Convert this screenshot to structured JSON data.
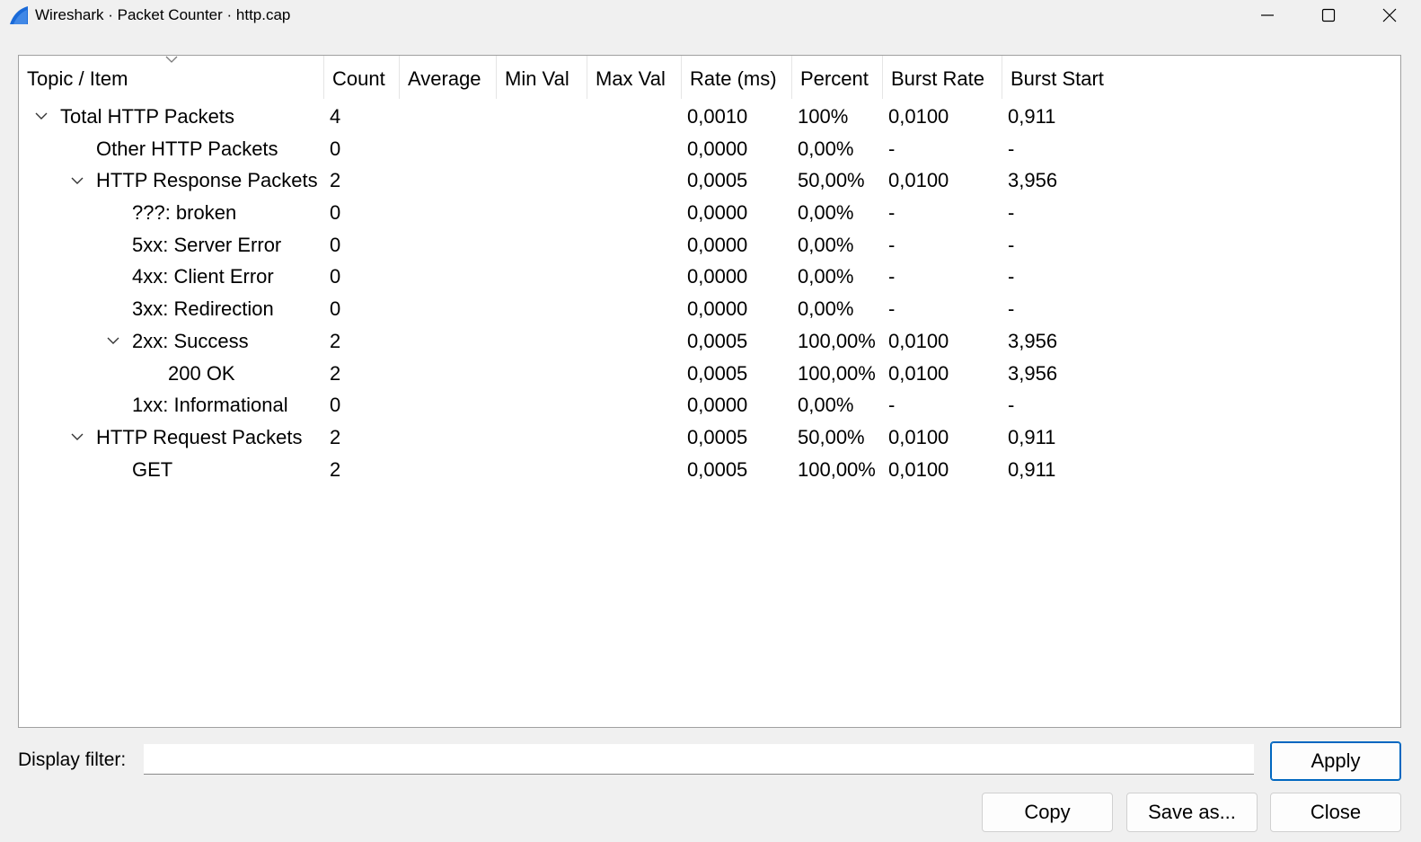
{
  "window": {
    "title": "Wireshark · Packet Counter · http.cap"
  },
  "icons": {
    "app": "wireshark-fin-icon",
    "minimize": "minimize-icon",
    "maximize": "maximize-icon",
    "close": "close-icon",
    "sort": "chevron-down-icon",
    "expand": "chevron-down-icon"
  },
  "colors": {
    "app_icon": "#1a6ad8",
    "default_button_border": "#0067c0"
  },
  "table": {
    "columns": [
      "Topic / Item",
      "Count",
      "Average",
      "Min Val",
      "Max Val",
      "Rate (ms)",
      "Percent",
      "Burst Rate",
      "Burst Start"
    ],
    "rows": [
      {
        "topic": "Total HTTP Packets",
        "level": 0,
        "expanded": true,
        "count": "4",
        "average": "",
        "min_val": "",
        "max_val": "",
        "rate": "0,0010",
        "percent": "100%",
        "burst_rate": "0,0100",
        "burst_start": "0,911"
      },
      {
        "topic": "Other HTTP Packets",
        "level": 1,
        "expanded": null,
        "count": "0",
        "average": "",
        "min_val": "",
        "max_val": "",
        "rate": "0,0000",
        "percent": "0,00%",
        "burst_rate": "-",
        "burst_start": "-"
      },
      {
        "topic": "HTTP Response Packets",
        "level": 1,
        "expanded": true,
        "count": "2",
        "average": "",
        "min_val": "",
        "max_val": "",
        "rate": "0,0005",
        "percent": "50,00%",
        "burst_rate": "0,0100",
        "burst_start": "3,956"
      },
      {
        "topic": "???: broken",
        "level": 2,
        "expanded": null,
        "count": "0",
        "average": "",
        "min_val": "",
        "max_val": "",
        "rate": "0,0000",
        "percent": "0,00%",
        "burst_rate": "-",
        "burst_start": "-"
      },
      {
        "topic": "5xx: Server Error",
        "level": 2,
        "expanded": null,
        "count": "0",
        "average": "",
        "min_val": "",
        "max_val": "",
        "rate": "0,0000",
        "percent": "0,00%",
        "burst_rate": "-",
        "burst_start": "-"
      },
      {
        "topic": "4xx: Client Error",
        "level": 2,
        "expanded": null,
        "count": "0",
        "average": "",
        "min_val": "",
        "max_val": "",
        "rate": "0,0000",
        "percent": "0,00%",
        "burst_rate": "-",
        "burst_start": "-"
      },
      {
        "topic": "3xx: Redirection",
        "level": 2,
        "expanded": null,
        "count": "0",
        "average": "",
        "min_val": "",
        "max_val": "",
        "rate": "0,0000",
        "percent": "0,00%",
        "burst_rate": "-",
        "burst_start": "-"
      },
      {
        "topic": "2xx: Success",
        "level": 2,
        "expanded": true,
        "count": "2",
        "average": "",
        "min_val": "",
        "max_val": "",
        "rate": "0,0005",
        "percent": "100,00%",
        "burst_rate": "0,0100",
        "burst_start": "3,956"
      },
      {
        "topic": "200 OK",
        "level": 3,
        "expanded": null,
        "count": "2",
        "average": "",
        "min_val": "",
        "max_val": "",
        "rate": "0,0005",
        "percent": "100,00%",
        "burst_rate": "0,0100",
        "burst_start": "3,956"
      },
      {
        "topic": "1xx: Informational",
        "level": 2,
        "expanded": null,
        "count": "0",
        "average": "",
        "min_val": "",
        "max_val": "",
        "rate": "0,0000",
        "percent": "0,00%",
        "burst_rate": "-",
        "burst_start": "-"
      },
      {
        "topic": "HTTP Request Packets",
        "level": 1,
        "expanded": true,
        "count": "2",
        "average": "",
        "min_val": "",
        "max_val": "",
        "rate": "0,0005",
        "percent": "50,00%",
        "burst_rate": "0,0100",
        "burst_start": "0,911"
      },
      {
        "topic": "GET",
        "level": 2,
        "expanded": null,
        "count": "2",
        "average": "",
        "min_val": "",
        "max_val": "",
        "rate": "0,0005",
        "percent": "100,00%",
        "burst_rate": "0,0100",
        "burst_start": "0,911"
      }
    ]
  },
  "filter": {
    "label": "Display filter:",
    "value": "",
    "placeholder": ""
  },
  "buttons": {
    "apply": "Apply",
    "copy": "Copy",
    "save_as": "Save as...",
    "close": "Close"
  }
}
